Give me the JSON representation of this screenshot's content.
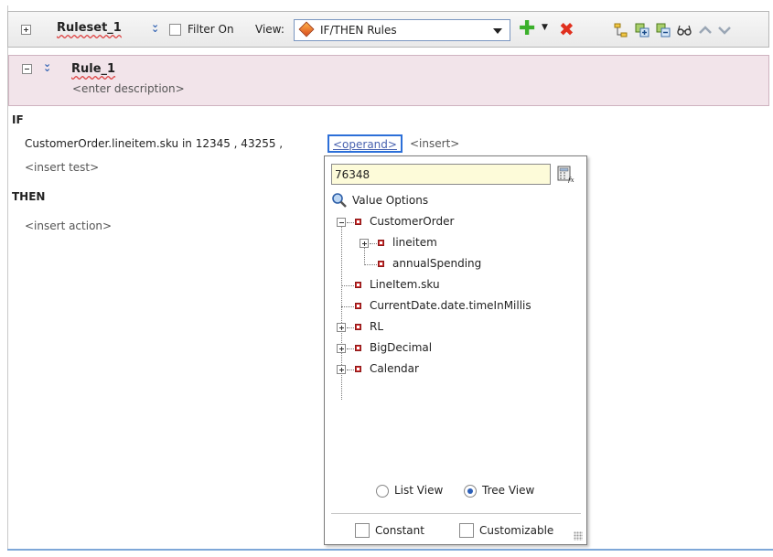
{
  "toolbar": {
    "ruleset_title": "Ruleset_1",
    "filter_label": "Filter On",
    "view_label": "View:",
    "view_selected": "IF/THEN Rules"
  },
  "rule": {
    "title": "Rule_1",
    "description": "<enter description>"
  },
  "rule_body": {
    "if_keyword": "IF",
    "condition_text": "CustomerOrder.lineitem.sku  in  12345 , 43255 ,",
    "operand_placeholder": "<operand>",
    "insert": "<insert>",
    "insert_test": "<insert test>",
    "then_keyword": "THEN",
    "insert_action": "<insert action>"
  },
  "popup": {
    "input_value": "76348",
    "value_options_label": "Value Options",
    "tree": [
      {
        "label": "CustomerOrder"
      },
      {
        "label": "lineitem"
      },
      {
        "label": "annualSpending"
      },
      {
        "label": "LineItem.sku"
      },
      {
        "label": "CurrentDate.date.timeInMillis"
      },
      {
        "label": "RL"
      },
      {
        "label": "BigDecimal"
      },
      {
        "label": "Calendar"
      }
    ],
    "list_view_label": "List View",
    "tree_view_label": "Tree View",
    "view_mode_selected": "Tree View",
    "constant_label": "Constant",
    "customizable_label": "Customizable"
  },
  "colors": {
    "rule_header_bg": "#f2e4ea",
    "operand_border": "#2c6fd8",
    "input_bg": "#fdfbd9",
    "tree_node": "#d12e2e",
    "add_icon": "#3bb02b",
    "delete_icon": "#e0301e"
  }
}
